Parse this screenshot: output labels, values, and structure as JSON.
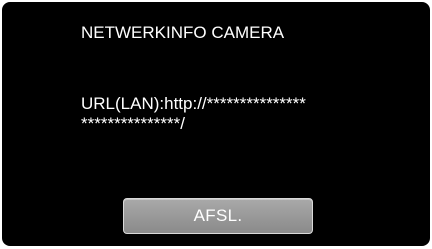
{
  "dialog": {
    "title": "NETWERKINFO CAMERA",
    "url_line1": "URL(LAN):http://***************",
    "url_line2": "***************/",
    "button_label": "AFSL."
  },
  "colors": {
    "background": "#000000",
    "text": "#ffffff",
    "button_fill": "#9a9a9a",
    "button_border": "#d9d9d9"
  }
}
